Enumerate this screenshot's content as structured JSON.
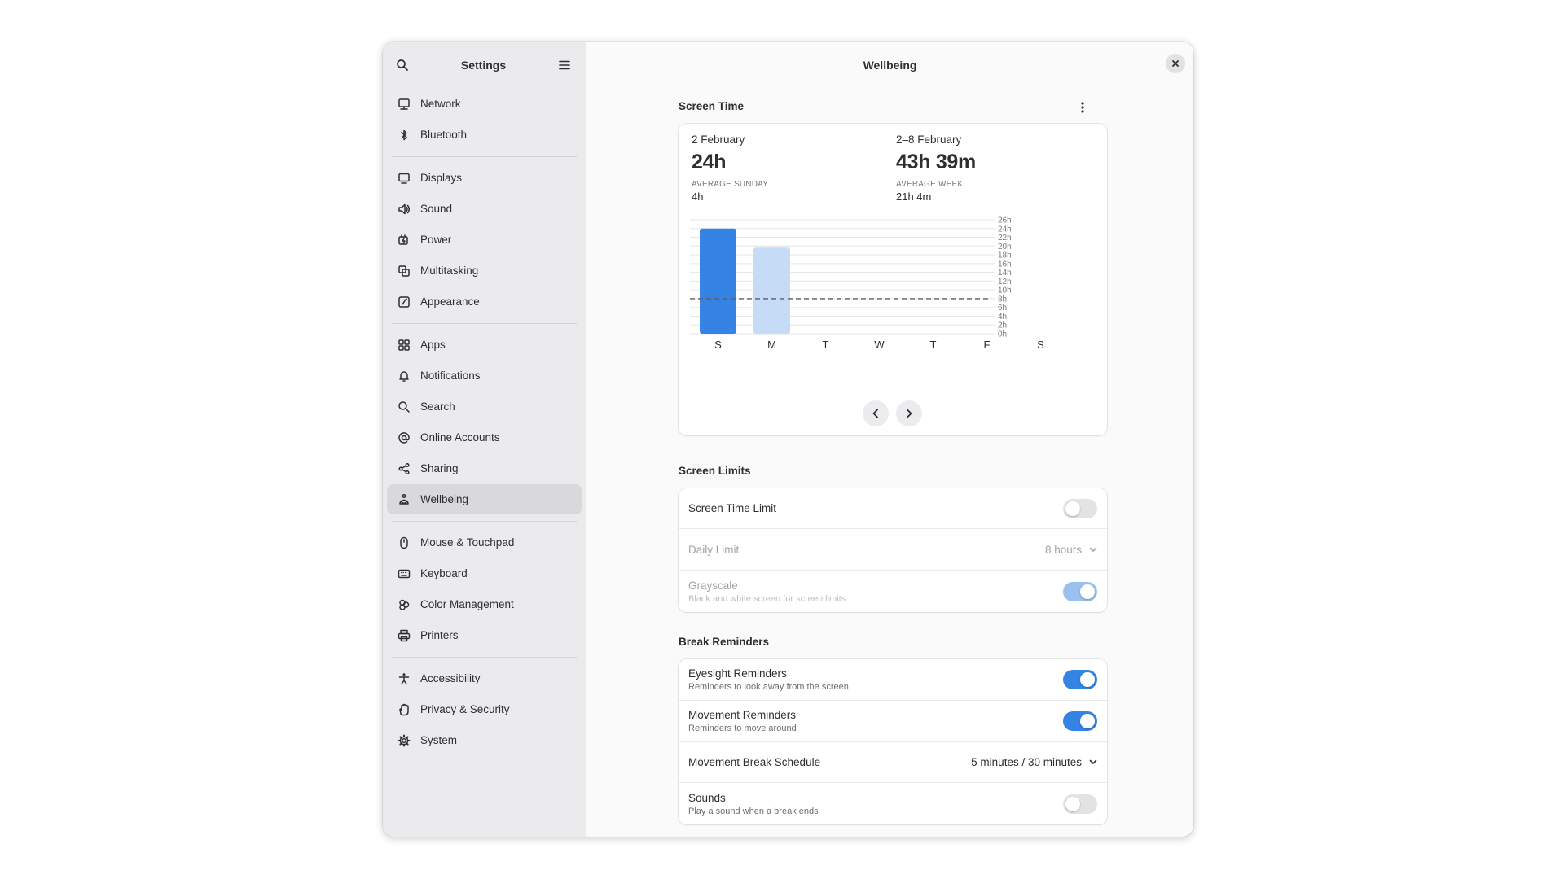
{
  "sidebar": {
    "title": "Settings",
    "groups": [
      [
        {
          "label": "Network",
          "icon": "network-icon"
        },
        {
          "label": "Bluetooth",
          "icon": "bluetooth-icon"
        }
      ],
      [
        {
          "label": "Displays",
          "icon": "display-icon"
        },
        {
          "label": "Sound",
          "icon": "speaker-icon"
        },
        {
          "label": "Power",
          "icon": "battery-icon"
        },
        {
          "label": "Multitasking",
          "icon": "multitasking-icon"
        },
        {
          "label": "Appearance",
          "icon": "appearance-icon"
        }
      ],
      [
        {
          "label": "Apps",
          "icon": "apps-grid-icon"
        },
        {
          "label": "Notifications",
          "icon": "bell-icon"
        },
        {
          "label": "Search",
          "icon": "search-icon"
        },
        {
          "label": "Online Accounts",
          "icon": "at-sign-icon"
        },
        {
          "label": "Sharing",
          "icon": "share-icon"
        },
        {
          "label": "Wellbeing",
          "icon": "wellbeing-icon",
          "active": true
        }
      ],
      [
        {
          "label": "Mouse & Touchpad",
          "icon": "mouse-icon"
        },
        {
          "label": "Keyboard",
          "icon": "keyboard-icon"
        },
        {
          "label": "Color Management",
          "icon": "color-icon"
        },
        {
          "label": "Printers",
          "icon": "printer-icon"
        }
      ],
      [
        {
          "label": "Accessibility",
          "icon": "accessibility-icon"
        },
        {
          "label": "Privacy & Security",
          "icon": "hand-icon"
        },
        {
          "label": "System",
          "icon": "gear-icon"
        }
      ]
    ]
  },
  "header": {
    "title": "Wellbeing"
  },
  "screen_time": {
    "section_title": "Screen Time",
    "day": {
      "date": "2 February",
      "total": "24h",
      "caption": "AVERAGE SUNDAY",
      "avg": "4h"
    },
    "week": {
      "date": "2–8 February",
      "total": "43h 39m",
      "caption": "AVERAGE WEEK",
      "avg": "21h 4m"
    }
  },
  "chart_data": {
    "type": "bar",
    "categories": [
      "S",
      "M",
      "T",
      "W",
      "T",
      "F",
      "S"
    ],
    "values": [
      24,
      19.65,
      0,
      0,
      0,
      0,
      0
    ],
    "highlight_index": 0,
    "y_ticks": [
      "0h",
      "2h",
      "4h",
      "6h",
      "8h",
      "10h",
      "12h",
      "14h",
      "16h",
      "18h",
      "20h",
      "22h",
      "24h",
      "26h"
    ],
    "ylim": [
      0,
      26
    ],
    "limit_line": 8,
    "colors": {
      "selected": "#3584e4",
      "other": "#c6dbf6",
      "grid": "#e6e6e8",
      "limit": "#5e5c64"
    }
  },
  "screen_limits": {
    "section_title": "Screen Limits",
    "screen_time_limit": {
      "label": "Screen Time Limit",
      "on": false
    },
    "daily_limit": {
      "label": "Daily Limit",
      "value": "8 hours"
    },
    "grayscale": {
      "label": "Grayscale",
      "subtitle": "Black and white screen for screen limits",
      "on": true
    }
  },
  "break_reminders": {
    "section_title": "Break Reminders",
    "eyesight": {
      "label": "Eyesight Reminders",
      "subtitle": "Reminders to look away from the screen",
      "on": true
    },
    "movement": {
      "label": "Movement Reminders",
      "subtitle": "Reminders to move around",
      "on": true
    },
    "schedule": {
      "label": "Movement Break Schedule",
      "value": "5 minutes / 30 minutes"
    },
    "sounds": {
      "label": "Sounds",
      "subtitle": "Play a sound when a break ends",
      "on": false
    }
  },
  "colors": {
    "accent": "#3584e4"
  }
}
